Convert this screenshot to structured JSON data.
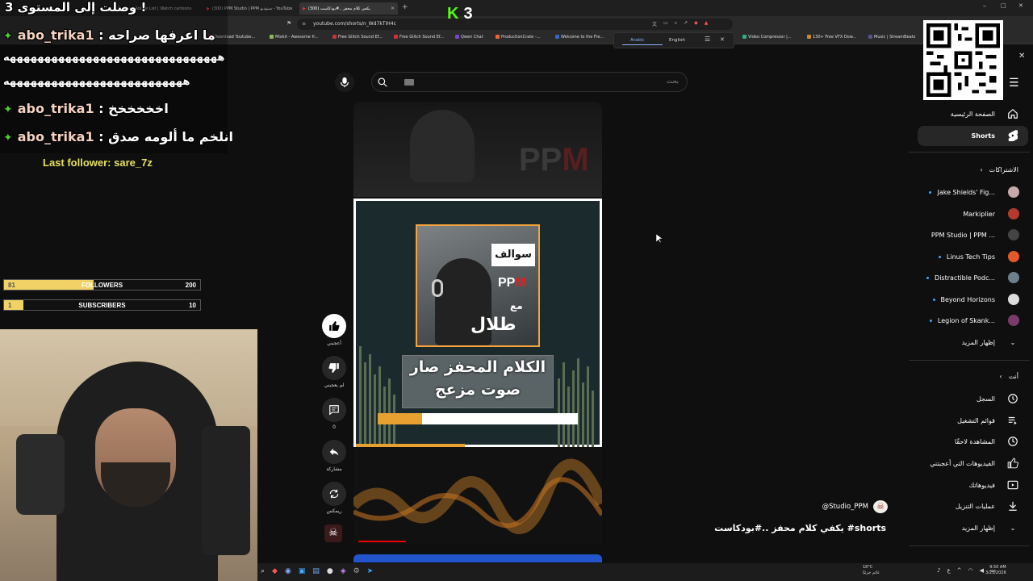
{
  "browser": {
    "tabs": [
      {
        "title": "Dubbed Anime List | Watch cartoons",
        "active": false
      },
      {
        "title": "(300) PPM Studio | PPM ستوديو - YouTube",
        "active": false
      },
      {
        "title": "(300) يكفي كلام محفز ..#بودكاست",
        "active": true
      }
    ],
    "url": "youtube.com/shorts/n_Wd7kTIH4c",
    "bookmarks": [
      "Download Youtube...",
      "Mixkit - Awesome fr...",
      "Free Glitch Sound Ef...",
      "Free Glitch Sound Ef...",
      "Qwen Chat",
      "ProductionCrate -...",
      "Welcome to the Fre...",
      "Video Compressor |...",
      "130+ Free VFX Dow...",
      "Music | StreamBeats"
    ],
    "translate": {
      "lang1": "Arabic",
      "lang2": "English"
    }
  },
  "youtube": {
    "search_placeholder": "بحث",
    "video": {
      "badge_top": "سوالف",
      "brand_pp": "PP",
      "brand_m": "M",
      "with": "مع",
      "guest": "طلال",
      "caption_line1": "الكلام المحفز صار",
      "caption_line2": "صوت مزعج",
      "progress": 0.22,
      "watched": 0.2
    },
    "actions": {
      "like": "أعجبني",
      "dislike": "لم يعجبني",
      "comments": "0",
      "share": "مشاركة",
      "remix": "ريمكس"
    },
    "channel_handle": "@Studio_PPM",
    "video_title": "يكفي كلام محفز ..#بودكاست #shorts",
    "sidebar": {
      "home": "الصفحة الرئيسية",
      "shorts": "Shorts",
      "subs_header": "الاشتراكات",
      "subs": [
        {
          "name": "Jake Shields' Fig...",
          "dot": true,
          "color": "#c8a9a9"
        },
        {
          "name": "Markiplier",
          "dot": false,
          "color": "#b33b2e"
        },
        {
          "name": "PPM Studio | PPM ...",
          "dot": false,
          "color": "#444444"
        },
        {
          "name": "Linus Tech Tips",
          "dot": true,
          "color": "#e25a29"
        },
        {
          "name": "Distractible Podc...",
          "dot": true,
          "color": "#6d7f8a"
        },
        {
          "name": "Beyond Horizons",
          "dot": true,
          "color": "#dddddd"
        },
        {
          "name": "Legion of Skank...",
          "dot": true,
          "color": "#7a3b6a"
        }
      ],
      "show_more": "إظهار المزيد",
      "you_header": "أنت",
      "you_items": [
        "السجل",
        "قوائم التشغيل",
        "المشاهدة لاحقًا",
        "الفيديوهات التي أعجبتني",
        "فيديوهاتك",
        "عمليات التنزيل"
      ],
      "show_more2": "إظهار المزيد"
    }
  },
  "overlay": {
    "level_banner": "وصلت إلى المستوى 3 !",
    "chat": [
      {
        "user": "abo_trika1",
        "msg": "ما اعرفها صراحه"
      },
      {
        "user": "",
        "msg": "هههههههههههههههههههههههههههههههه"
      },
      {
        "user": "",
        "msg": "ههههههههههههههههههههههههههه"
      },
      {
        "user": "abo_trika1",
        "msg": "اخخخخخخ"
      },
      {
        "user": "abo_trika1",
        "msg": "انلخم ما ألومه صدق"
      }
    ],
    "last_follower": "Last follower: sare_7z",
    "followers": {
      "label": "FOLLOWERS",
      "current": "81",
      "goal": "200",
      "fraction": 0.455
    },
    "subscribers": {
      "label": "SUBSCRIBERS",
      "current": "1",
      "goal": "10",
      "fraction": 0.1
    },
    "k3": "3"
  },
  "taskbar": {
    "temp": "18°C",
    "weather": "غائم جزئيًا",
    "time": "9:50 AM",
    "date": "3/25/2026"
  }
}
